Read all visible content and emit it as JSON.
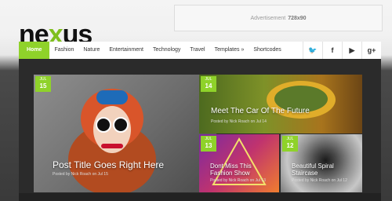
{
  "logo": {
    "part1": "ne",
    "x": "x",
    "part2": "us"
  },
  "ad": {
    "text": "Advertisement",
    "size": "728x90"
  },
  "nav": {
    "items": [
      "Home",
      "Fashion",
      "Nature",
      "Entertainment",
      "Technology",
      "Travel",
      "Templates »",
      "Shortcodes"
    ],
    "social": [
      {
        "icon": "twitter-icon",
        "glyph": "🐦"
      },
      {
        "icon": "facebook-icon",
        "glyph": "f"
      },
      {
        "icon": "youtube-icon",
        "glyph": "▶"
      },
      {
        "icon": "google-plus-icon",
        "glyph": "g+"
      }
    ]
  },
  "posts": [
    {
      "month": "JUL",
      "day": "15",
      "title": "Post Title Goes Right Here",
      "meta": "Posted by Nick Roach on Jul 15"
    },
    {
      "month": "JUL",
      "day": "14",
      "title": "Meet The Car Of The Future",
      "meta": "Posted by Nick Roach on Jul 14"
    },
    {
      "month": "JUL",
      "day": "13",
      "title": "Dont Miss This Fashion Show",
      "meta": "Posted by Nick Roach on Jul 13"
    },
    {
      "month": "JUL",
      "day": "12",
      "title": "Beautiful Spiral Staircase",
      "meta": "Posted by Nick Roach on Jul 12"
    }
  ],
  "colors": {
    "accent": "#8fd22a",
    "dark": "#2b2b2b"
  }
}
